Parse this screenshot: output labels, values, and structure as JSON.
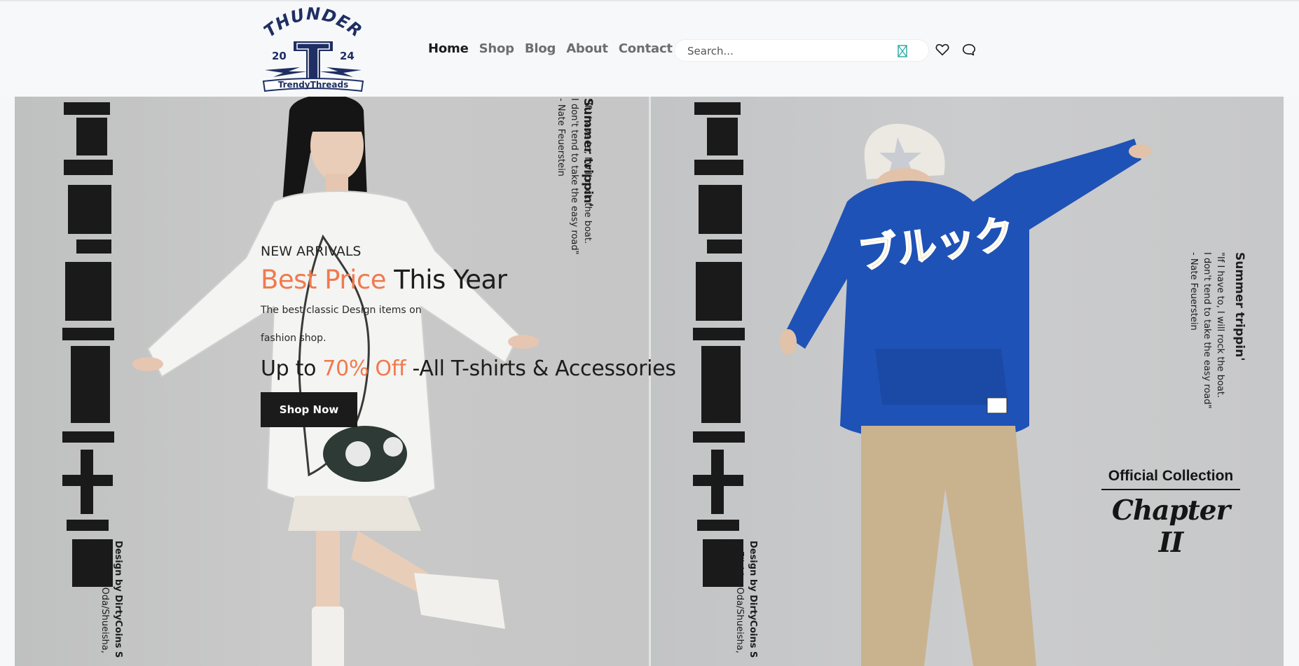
{
  "brand": {
    "logo_top": "THUNDER",
    "logo_left_num": "20",
    "logo_right_num": "24",
    "logo_letter": "T",
    "logo_bottom": "TrendyThreads"
  },
  "nav": {
    "items": [
      "Home",
      "Shop",
      "Blog",
      "About",
      "Contact Us"
    ],
    "active": "Home"
  },
  "search": {
    "placeholder": "Search..."
  },
  "icons": {
    "search": "search-icon",
    "wishlist": "heart-icon",
    "chat": "chat-bubble-icon"
  },
  "hero": {
    "kicker": "NEW ARRIVALS",
    "headline_accent": "Best Price",
    "headline_rest": " This Year",
    "desc_line1": "The best classic Design items on",
    "desc_line2": "fashion shop.",
    "offer_pre": "Up to ",
    "offer_accent": "70% Off",
    "offer_rest": " -All T-shirts & Accessories",
    "cta": "Shop Now"
  },
  "poster": {
    "quote_title": "Summer trippin'",
    "quote_line1": "\"If I have to, I will rock the boat.",
    "quote_line2": "I don't tend to take the easy road\"",
    "quote_line3": "- Nate Feuerstein",
    "credit_line1": "Design by DirtyCoins S",
    "credit_line2": "©Eiichiro Oda/Shueisha, Toei An",
    "hoodie_text": "ブルック",
    "official_line1": "Official Collection",
    "official_line2": "Chapter II"
  },
  "colors": {
    "accent": "#f07a4e",
    "dark": "#1b1b1b",
    "logo_navy": "#1f2f63"
  }
}
